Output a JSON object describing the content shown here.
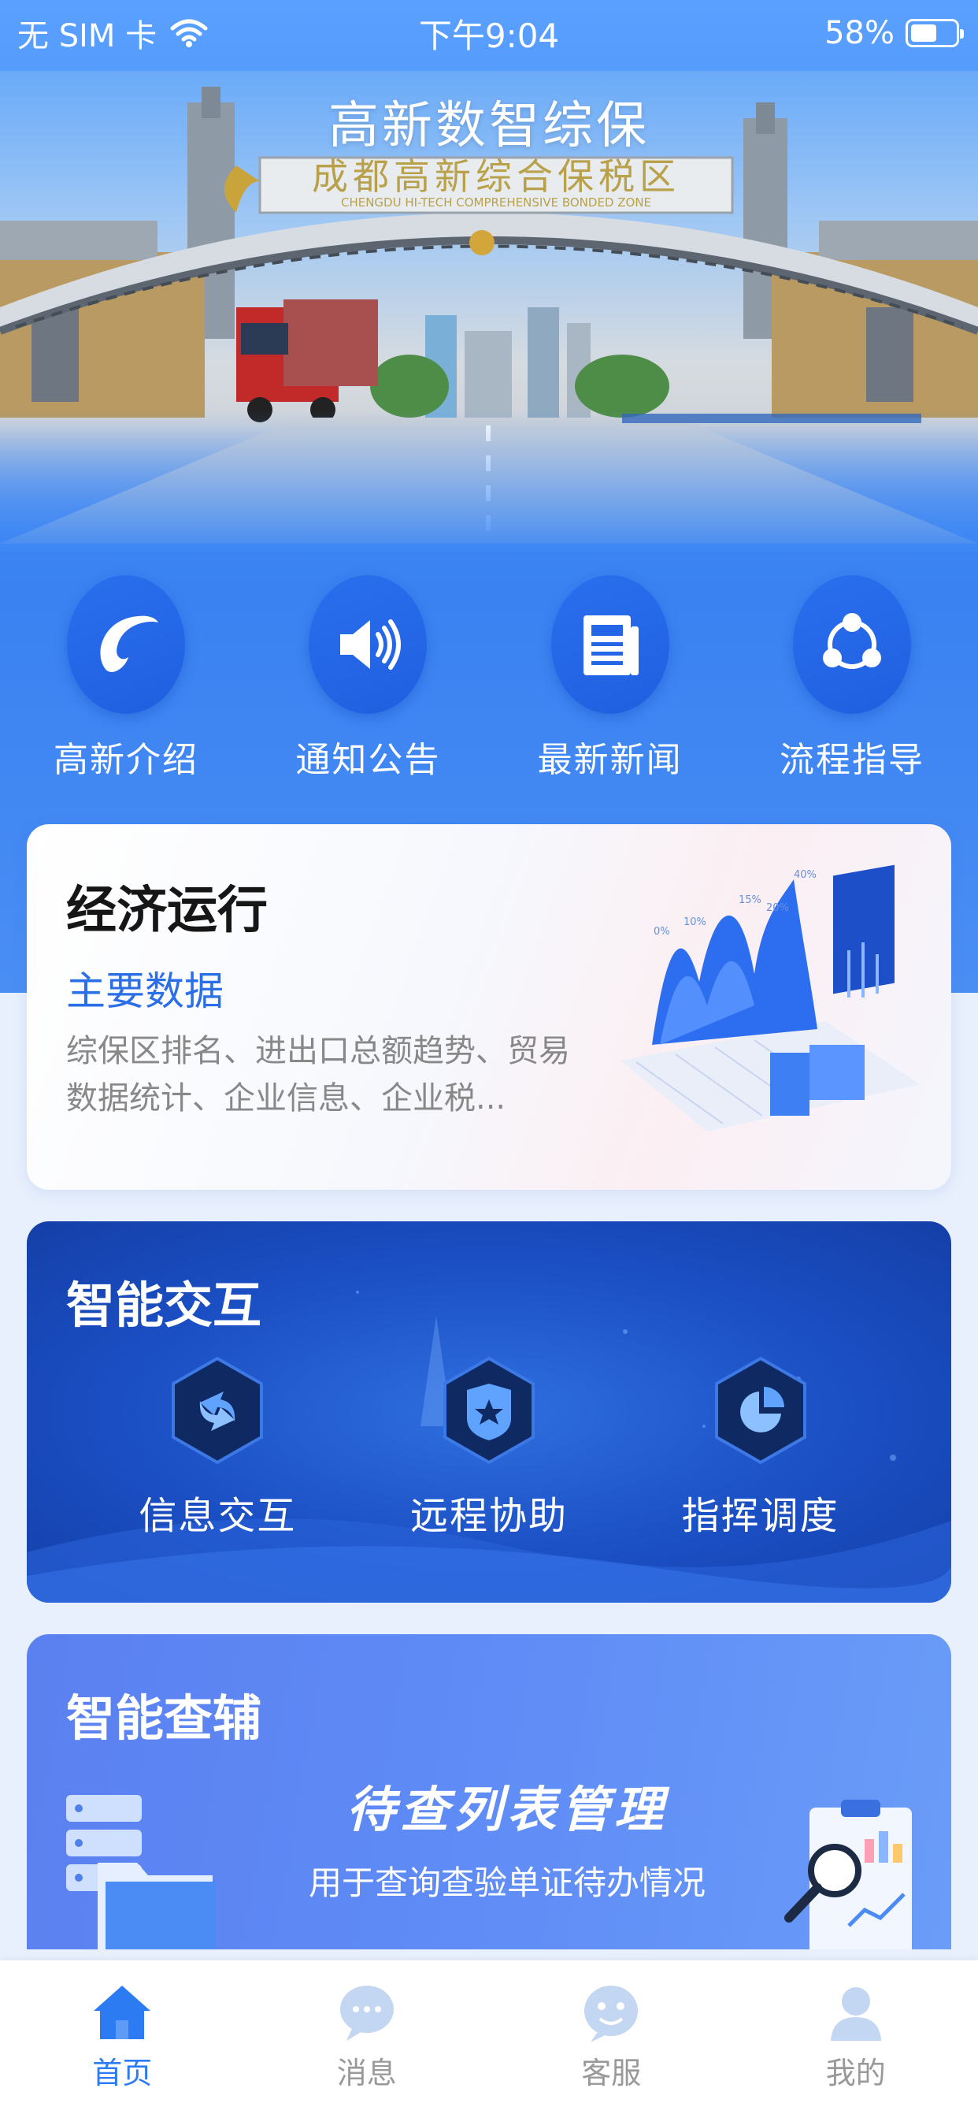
{
  "status_bar": {
    "carrier": "无 SIM 卡",
    "time": "下午9:04",
    "battery": "58%",
    "battery_level": 0.58
  },
  "app": {
    "title": "高新数智综保"
  },
  "hero": {
    "gate_sign_cn": "成都高新综合保税区",
    "gate_sign_en": "CHENGDU HI-TECH COMPREHENSIVE BONDED ZONE"
  },
  "quick_entries": [
    {
      "label": "高新介绍",
      "icon": "swirl-logo-icon"
    },
    {
      "label": "通知公告",
      "icon": "speaker-icon"
    },
    {
      "label": "最新新闻",
      "icon": "newspaper-icon"
    },
    {
      "label": "流程指导",
      "icon": "share-nodes-icon"
    }
  ],
  "economy": {
    "title": "经济运行",
    "subtitle": "主要数据",
    "description": "综保区排名、进出口总额趋势、贸易数据统计、企业信息、企业税...",
    "chart_labels": [
      "0%",
      "10%",
      "15%",
      "20%",
      "40%"
    ]
  },
  "interact": {
    "title": "智能交互",
    "items": [
      {
        "label": "信息交互",
        "icon": "exchange-arrows-icon"
      },
      {
        "label": "远程协助",
        "icon": "badge-star-icon"
      },
      {
        "label": "指挥调度",
        "icon": "pie-chart-icon"
      }
    ]
  },
  "check": {
    "title": "智能查辅",
    "banner": "待查列表管理",
    "description": "用于查询查验单证待办情况"
  },
  "tabs": [
    {
      "label": "首页",
      "icon": "home-icon",
      "active": true
    },
    {
      "label": "消息",
      "icon": "chat-bubble-icon",
      "active": false
    },
    {
      "label": "客服",
      "icon": "customer-service-icon",
      "active": false
    },
    {
      "label": "我的",
      "icon": "user-icon",
      "active": false
    }
  ],
  "colors": {
    "primary": "#2c7bf2",
    "hero_blue": "#3f8cf6",
    "tab_inactive": "#999999"
  }
}
